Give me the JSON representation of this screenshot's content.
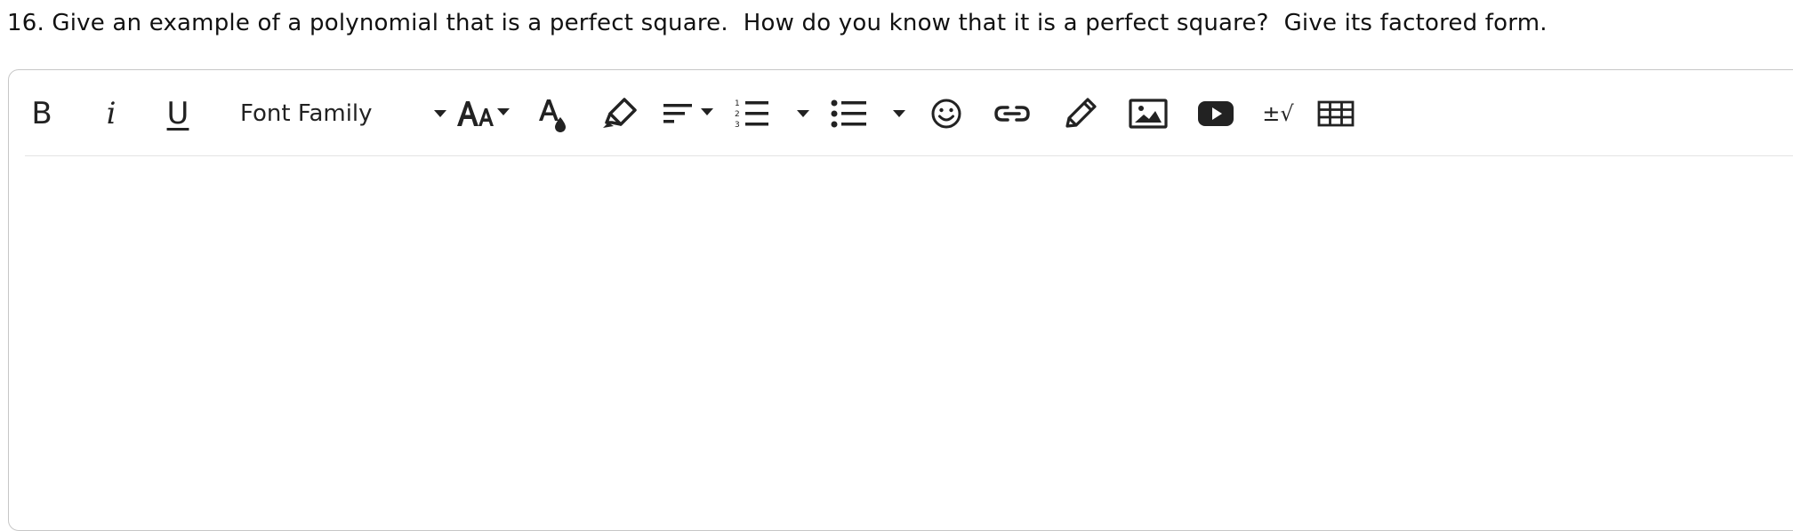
{
  "question": {
    "text": "16. Give an example of a polynomial that is a perfect square.  How do you know that it is a perfect square?  Give its factored form."
  },
  "toolbar": {
    "bold_label": "B",
    "italic_label": "i",
    "underline_label": "U",
    "font_family_label": "Font Family",
    "math_label": "±√",
    "icons": [
      "bold-icon",
      "italic-icon",
      "underline-icon",
      "font-family-dropdown",
      "font-size-icon",
      "text-color-icon",
      "highlight-icon",
      "align-icon",
      "numbered-list-icon",
      "bullet-list-icon",
      "emoji-icon",
      "link-icon",
      "draw-icon",
      "image-icon",
      "video-icon",
      "math-icon",
      "table-icon"
    ]
  },
  "editor": {
    "content": ""
  },
  "colors": {
    "icon": "#222222",
    "border": "#c7c7c7",
    "divider": "#e3e3e3"
  }
}
